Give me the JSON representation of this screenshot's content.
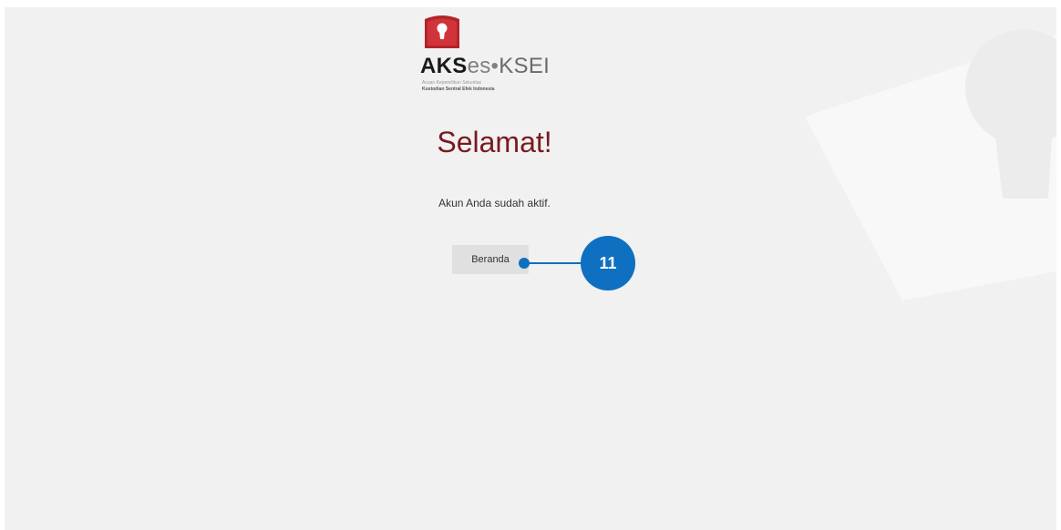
{
  "logo": {
    "brand_aks": "AKS",
    "brand_es": "es",
    "brand_dot": "•",
    "brand_ksei": "KSEI",
    "tagline": "Acuan Kepemilikan Sekuritas",
    "company": "Kustodian Sentral Efek Indonesia"
  },
  "main": {
    "title": "Selamat!",
    "message": "Akun Anda sudah aktif.",
    "home_button_label": "Beranda"
  },
  "annotation": {
    "step_number": "11"
  },
  "colors": {
    "title": "#7a1a1e",
    "logo_red": "#c0272d",
    "callout_blue": "#0f6fc0",
    "background": "#f1f1f1"
  },
  "icons": {
    "logo_emblem": "keyhole-shield-icon"
  }
}
